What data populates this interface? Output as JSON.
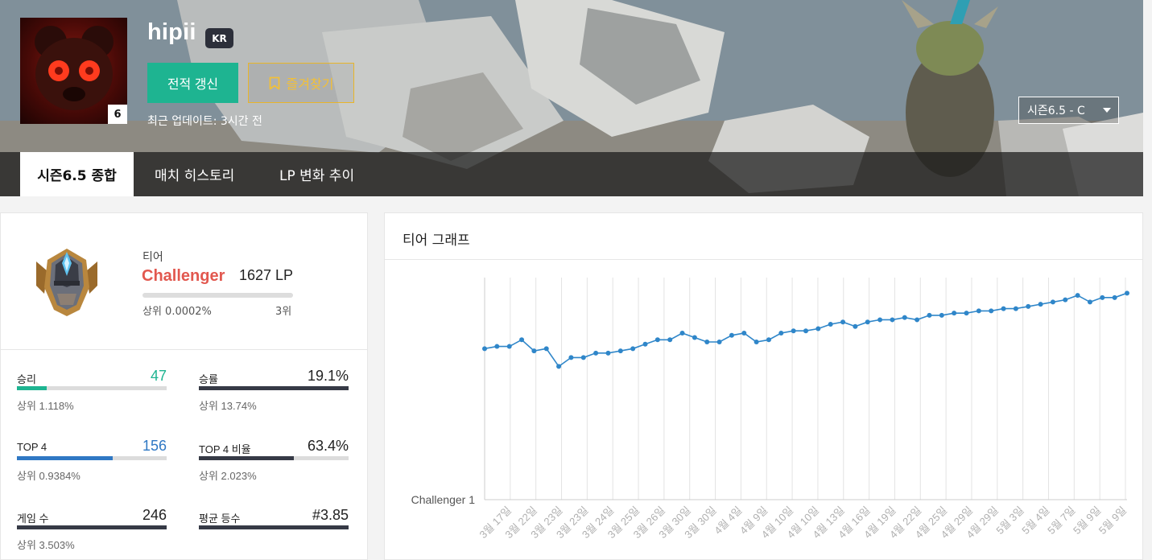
{
  "header": {
    "summoner_name": "hipii",
    "region": "KR",
    "level": "6",
    "refresh_label": "전적 갱신",
    "favorite_label": "즐겨찾기",
    "last_update": "최근 업데이트: 3시간 전",
    "season_select": "시즌6.5 - C"
  },
  "tabs": [
    {
      "label": "시즌6.5 종합"
    },
    {
      "label": "매치 히스토리"
    },
    {
      "label": "LP 변화 추이"
    }
  ],
  "tier": {
    "label": "티어",
    "name": "Challenger",
    "lp": "1627 LP",
    "top_percent": "상위 0.0002%",
    "rank": "3위"
  },
  "stats": [
    {
      "label": "승리",
      "value": "47",
      "sub": "상위 1.118%",
      "fill": 0.2,
      "color": "#1eb491"
    },
    {
      "label": "승률",
      "value": "19.1%",
      "sub": "상위 13.74%",
      "fill": 1.0,
      "color": "#363a46"
    },
    {
      "label": "TOP 4",
      "value": "156",
      "sub": "상위 0.9384%",
      "fill": 0.64,
      "color": "#2f78c4"
    },
    {
      "label": "TOP 4 비율",
      "value": "63.4%",
      "sub": "상위 2.023%",
      "fill": 0.634,
      "color": "#363a46"
    },
    {
      "label": "게임 수",
      "value": "246",
      "sub": "상위 3.503%",
      "fill": 1.0,
      "color": "#363a46"
    },
    {
      "label": "평균 등수",
      "value": "#3.85",
      "sub": "",
      "fill": 1.0,
      "color": "#363a46"
    }
  ],
  "graph": {
    "title": "티어 그래프"
  },
  "chart_data": {
    "type": "line",
    "ylabel_tick": "Challenger 1",
    "ylim": [
      0,
      100
    ],
    "grid": "vertical",
    "x_tick_labels": [
      "3월 17일",
      "3월 22일",
      "3월 23일",
      "3월 23일",
      "3월 24일",
      "3월 25일",
      "3월 26일",
      "3월 30일",
      "3월 30일",
      "4월 4일",
      "4월 9일",
      "4월 10일",
      "4월 10일",
      "4월 13일",
      "4월 16일",
      "4월 19일",
      "4월 22일",
      "4월 25일",
      "4월 29일",
      "4월 29일",
      "5월 3일",
      "5월 4일",
      "5월 7일",
      "5월 9일",
      "5월 9일"
    ],
    "series": [
      {
        "values": [
          68,
          69,
          69,
          72,
          67,
          68,
          60,
          64,
          64,
          66,
          66,
          67,
          68,
          70,
          72,
          72,
          75,
          73,
          71,
          71,
          74,
          75,
          71,
          72,
          75,
          76,
          76,
          77,
          79,
          80,
          78,
          80,
          81,
          81,
          82,
          81,
          83,
          83,
          84,
          84,
          85,
          85,
          86,
          86,
          87,
          88,
          89,
          90,
          92,
          89,
          91,
          91,
          93
        ]
      }
    ]
  }
}
